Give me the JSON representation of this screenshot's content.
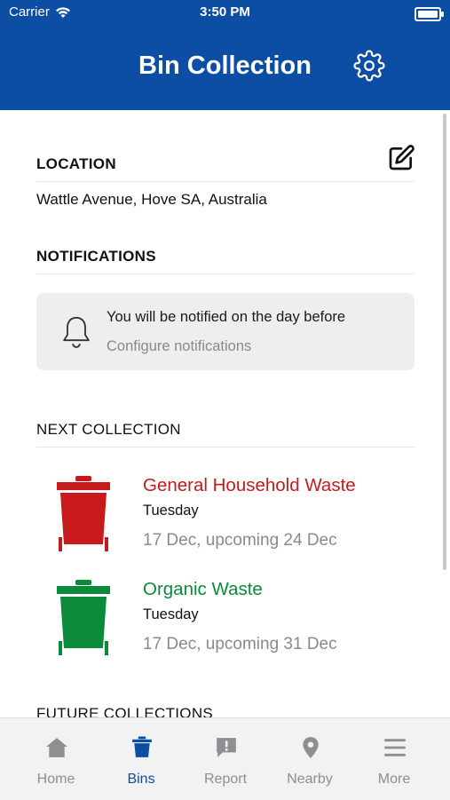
{
  "status_bar": {
    "carrier": "Carrier",
    "time": "3:50 PM"
  },
  "header": {
    "title": "Bin Collection"
  },
  "location": {
    "heading": "LOCATION",
    "address": "Wattle Avenue, Hove SA, Australia"
  },
  "notifications": {
    "heading": "NOTIFICATIONS",
    "message": "You will be notified on the day before",
    "link": "Configure notifications"
  },
  "next_collection": {
    "heading": "NEXT COLLECTION",
    "items": [
      {
        "name": "General Household Waste",
        "day": "Tuesday",
        "dates": "17 Dec, upcoming 24 Dec",
        "color": "#c81a1c"
      },
      {
        "name": "Organic Waste",
        "day": "Tuesday",
        "dates": "17 Dec, upcoming 31 Dec",
        "color": "#0a8a3a"
      }
    ]
  },
  "future_collections": {
    "heading": "FUTURE COLLECTIONS"
  },
  "tabs": [
    {
      "label": "Home",
      "icon": "home-icon"
    },
    {
      "label": "Bins",
      "icon": "bin-icon",
      "active": true
    },
    {
      "label": "Report",
      "icon": "report-icon"
    },
    {
      "label": "Nearby",
      "icon": "location-pin-icon"
    },
    {
      "label": "More",
      "icon": "menu-icon"
    }
  ],
  "colors": {
    "brand": "#0d4ea5",
    "muted": "#8a8a8a"
  }
}
